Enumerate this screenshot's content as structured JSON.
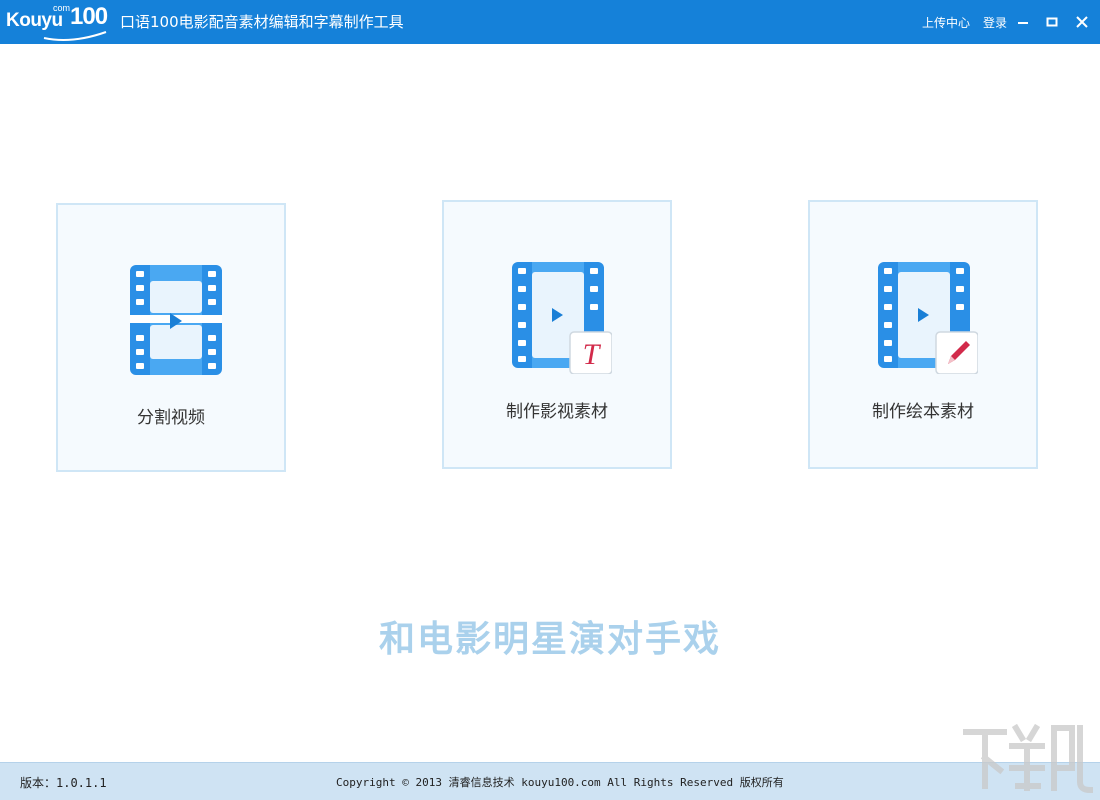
{
  "titlebar": {
    "logo_word": "Kouyu",
    "logo_com": "com",
    "logo_num": "100",
    "title": "口语100电影配音素材编辑和字幕制作工具",
    "upload_center": "上传中心",
    "login": "登录"
  },
  "cards": [
    {
      "label": "分割视频",
      "icon": "film-icon"
    },
    {
      "label": "制作影视素材",
      "icon": "film-text-icon"
    },
    {
      "label": "制作绘本素材",
      "icon": "film-pencil-icon"
    }
  ],
  "slogan": "和电影明星演对手戏",
  "statusbar": {
    "version": "版本：1.0.1.1",
    "copyright": "Copyright © 2013 清睿信息技术 kouyu100.com All Rights Reserved 版权所有"
  },
  "colors": {
    "titlebar": "#1581d9",
    "card_border": "#cfe6f6",
    "card_bg": "#f5fafe",
    "slogan": "#aad1ec",
    "statusbar": "#cfe3f3",
    "film_icon": "#2a8fe6"
  }
}
